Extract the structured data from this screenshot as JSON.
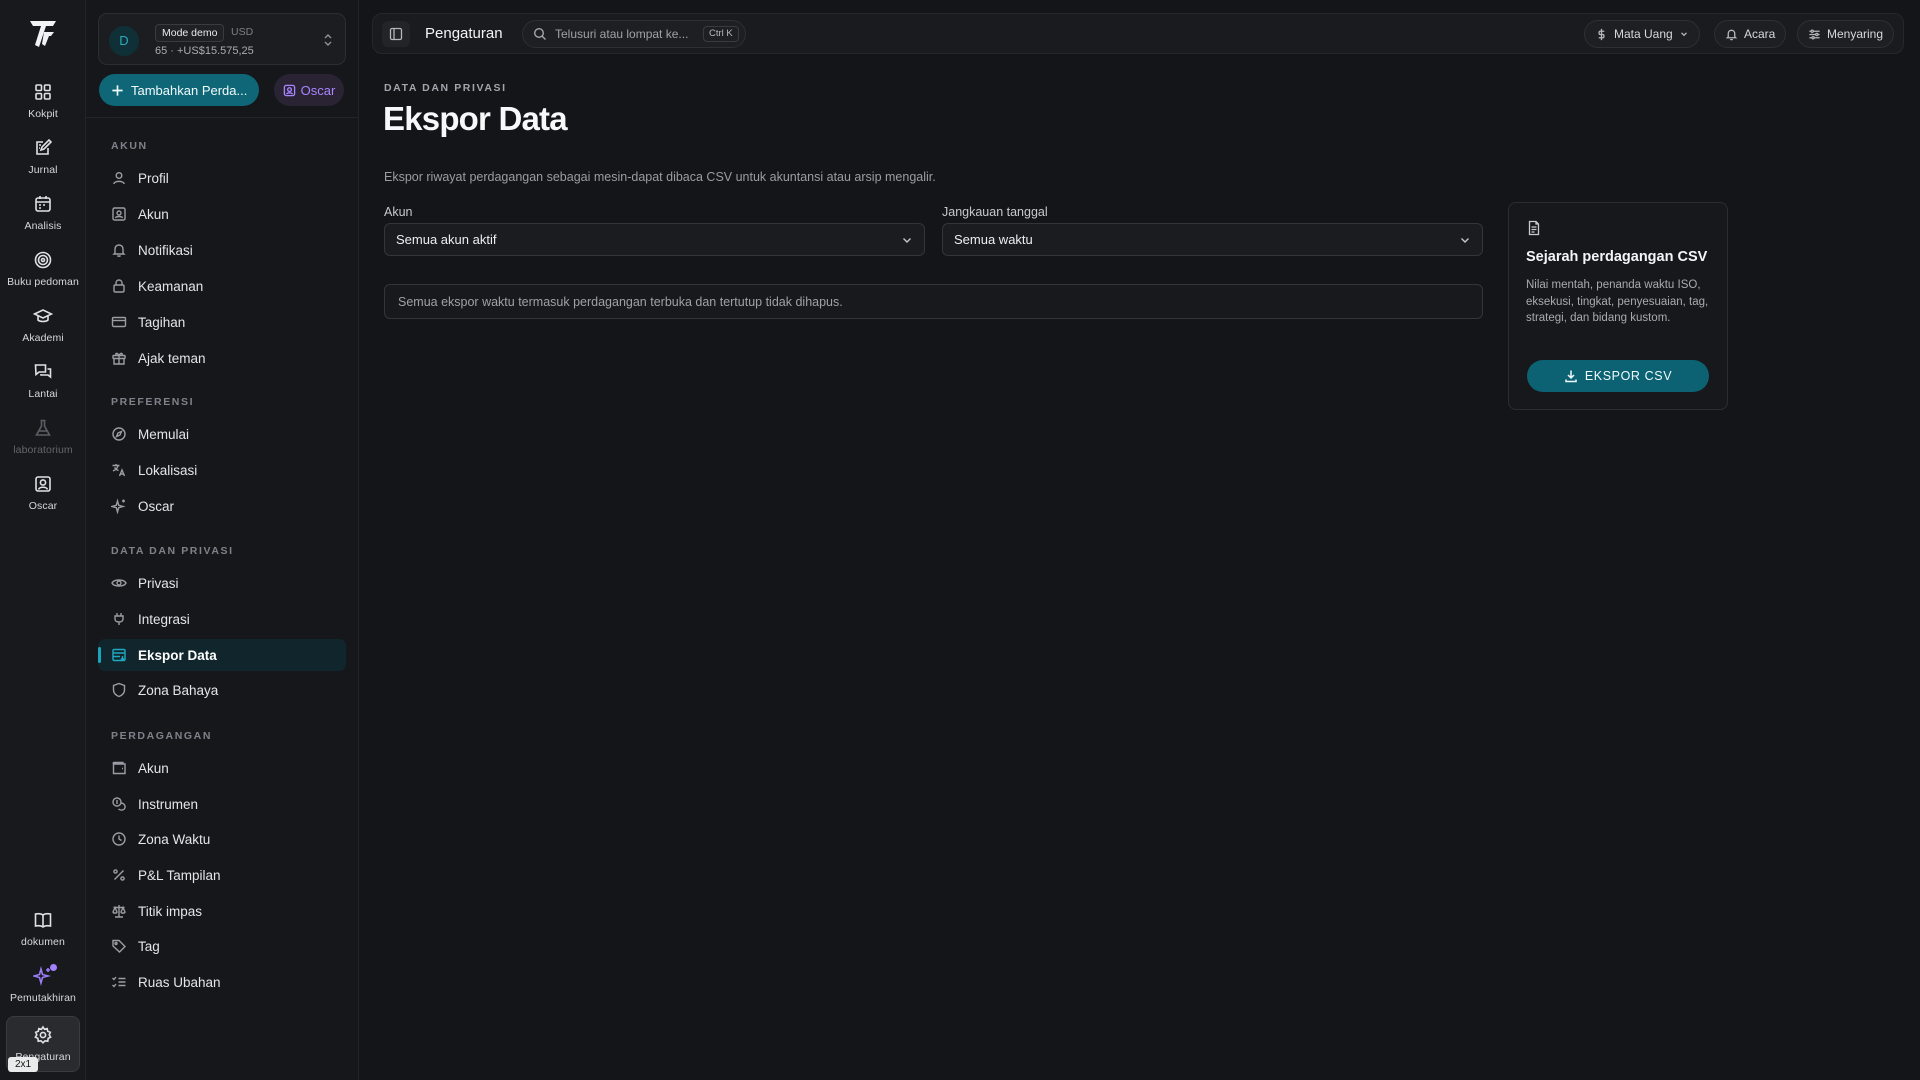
{
  "rail": {
    "items": [
      {
        "label": "Kokpit",
        "icon": "grid-icon"
      },
      {
        "label": "Jurnal",
        "icon": "journal-edit-icon"
      },
      {
        "label": "Analisis",
        "icon": "calendar-icon"
      },
      {
        "label": "Buku pedoman",
        "icon": "target-icon"
      },
      {
        "label": "Akademi",
        "icon": "graduation-cap-icon"
      },
      {
        "label": "Lantai",
        "icon": "chat-bubbles-icon"
      },
      {
        "label": "laboratorium",
        "icon": "flask-icon"
      },
      {
        "label": "Oscar",
        "icon": "user-square-icon"
      }
    ],
    "bottom_items": [
      {
        "label": "dokumen",
        "icon": "book-open-icon"
      },
      {
        "label": "Pemutakhiran",
        "icon": "sparkles-icon"
      },
      {
        "label": "Pengaturan",
        "icon": "gear-icon"
      }
    ],
    "size_badge": "2x1"
  },
  "account": {
    "avatar_letter": "D",
    "mode_badge": "Mode demo",
    "currency": "USD",
    "balance": "65 · +US$15.575,25"
  },
  "sidebar": {
    "add_button": "Tambahkan Perda...",
    "oscar_button": "Oscar",
    "sections": {
      "akun": "AKUN",
      "preferensi": "PREFERENSI",
      "data_privasi": "DATA DAN PRIVASI",
      "perdagangan": "PERDAGANGAN"
    },
    "akun_items": [
      {
        "label": "Profil",
        "icon": "user-icon"
      },
      {
        "label": "Akun",
        "icon": "id-card-icon"
      },
      {
        "label": "Notifikasi",
        "icon": "bell-icon"
      },
      {
        "label": "Keamanan",
        "icon": "lock-icon"
      },
      {
        "label": "Tagihan",
        "icon": "credit-card-icon"
      },
      {
        "label": "Ajak teman",
        "icon": "gift-icon"
      }
    ],
    "preferensi_items": [
      {
        "label": "Memulai",
        "icon": "compass-icon"
      },
      {
        "label": "Lokalisasi",
        "icon": "translate-icon"
      },
      {
        "label": "Oscar",
        "icon": "sparkle-icon"
      }
    ],
    "privasi_items": [
      {
        "label": "Privasi",
        "icon": "eye-icon"
      },
      {
        "label": "Integrasi",
        "icon": "plug-icon"
      },
      {
        "label": "Ekspor Data",
        "icon": "database-export-icon"
      },
      {
        "label": "Zona Bahaya",
        "icon": "shield-icon"
      }
    ],
    "perdagangan_items": [
      {
        "label": "Akun",
        "icon": "wallet-icon"
      },
      {
        "label": "Instrumen",
        "icon": "coins-icon"
      },
      {
        "label": "Zona Waktu",
        "icon": "clock-icon"
      },
      {
        "label": "P&L Tampilan",
        "icon": "percent-icon"
      },
      {
        "label": "Titik impas",
        "icon": "scale-icon"
      },
      {
        "label": "Tag",
        "icon": "tag-icon"
      },
      {
        "label": "Ruas Ubahan",
        "icon": "list-checks-icon"
      }
    ]
  },
  "topbar": {
    "title": "Pengaturan",
    "search_placeholder": "Telusuri atau lompat ke...",
    "search_shortcut": "Ctrl K",
    "currency_button": "Mata Uang",
    "events_button": "Acara",
    "filter_button": "Menyaring"
  },
  "main": {
    "breadcrumb": "DATA DAN PRIVASI",
    "title": "Ekspor Data",
    "description": "Ekspor riwayat perdagangan sebagai mesin-dapat dibaca CSV untuk akuntansi atau arsip mengalir.",
    "account_label": "Akun",
    "account_value": "Semua akun aktif",
    "range_label": "Jangkauan tanggal",
    "range_value": "Semua waktu",
    "note": "Semua ekspor waktu termasuk perdagangan terbuka dan tertutup tidak dihapus."
  },
  "export_card": {
    "title": "Sejarah perdagangan CSV",
    "description": "Nilai mentah, penanda waktu ISO, eksekusi, tingkat, penyesuaian, tag, strategi, dan bidang kustom.",
    "button": "EKSPOR CSV"
  },
  "colors": {
    "accent": "#0e6677",
    "active_bg": "#10262c",
    "purple": "#a785ff"
  }
}
